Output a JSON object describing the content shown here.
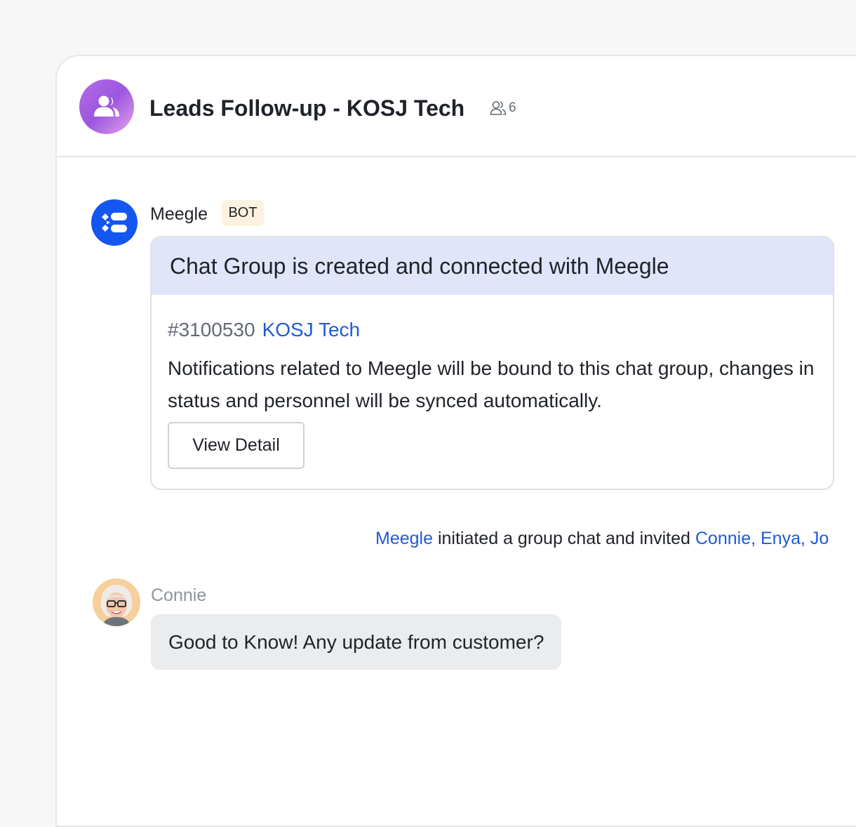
{
  "header": {
    "title": "Leads Follow-up - KOSJ Tech",
    "member_count": "6",
    "group_icon": "group-icon",
    "members_icon": "members-icon"
  },
  "bot_message": {
    "sender": "Meegle",
    "badge": "BOT",
    "avatar_icon": "meegle-logo-icon",
    "card": {
      "title": "Chat Group is created and connected with Meegle",
      "ref_number": "#3100530",
      "ref_link": "KOSJ Tech",
      "body": "Notifications related to Meegle will be bound to this chat group, changes in status and personnel will be synced automatically.",
      "button_label": "View Detail"
    }
  },
  "system_message": {
    "actor": "Meegle",
    "text": " initiated a group chat and invited ",
    "invitees": "Connie, Enya, Jo"
  },
  "user_message": {
    "sender": "Connie",
    "text": "Good to Know! Any update from customer?"
  },
  "colors": {
    "accent_link": "#1f5bd6",
    "bot_avatar": "#1456f0",
    "card_header": "#e1e5fa",
    "badge_bg": "#fdf1e0",
    "bubble_bg": "#ebecee"
  }
}
